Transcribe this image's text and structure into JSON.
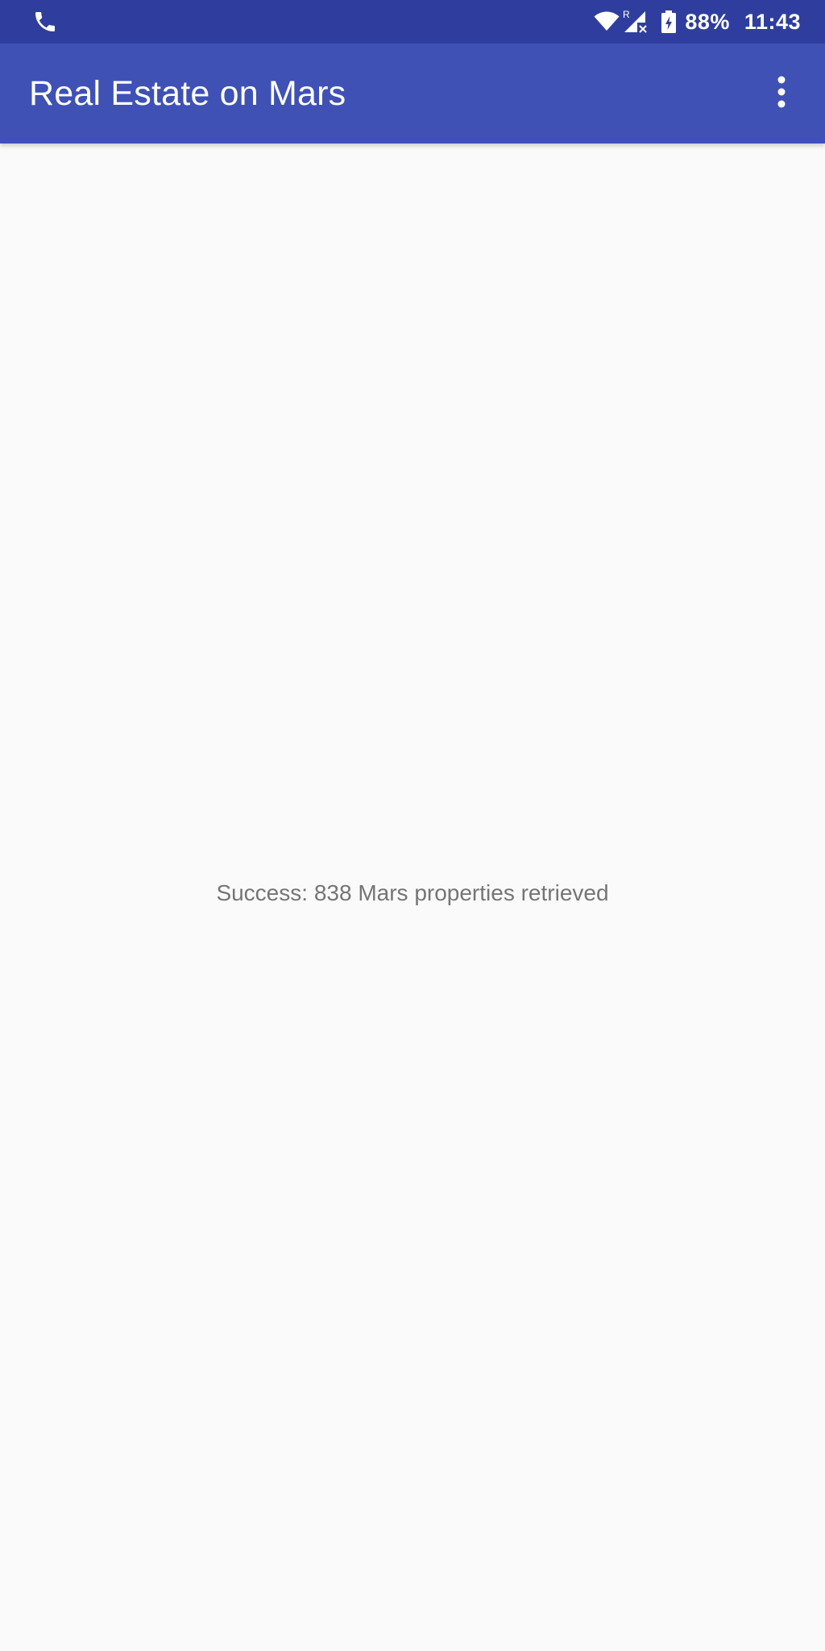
{
  "status_bar": {
    "left_icon": "phone-icon",
    "wifi_icon": "wifi-icon",
    "roaming_label": "R",
    "signal_icon": "signal-icon",
    "battery_icon": "battery-charging-icon",
    "battery_percent": "88%",
    "time": "11:43"
  },
  "app_bar": {
    "title": "Real Estate on Mars",
    "overflow_icon": "more-vert-icon"
  },
  "main": {
    "status_message": "Success: 838 Mars properties retrieved"
  },
  "colors": {
    "status_bar_bg": "#2f3e9e",
    "app_bar_bg": "#3f51b5",
    "background": "#fafafa",
    "message_text": "#757575"
  }
}
